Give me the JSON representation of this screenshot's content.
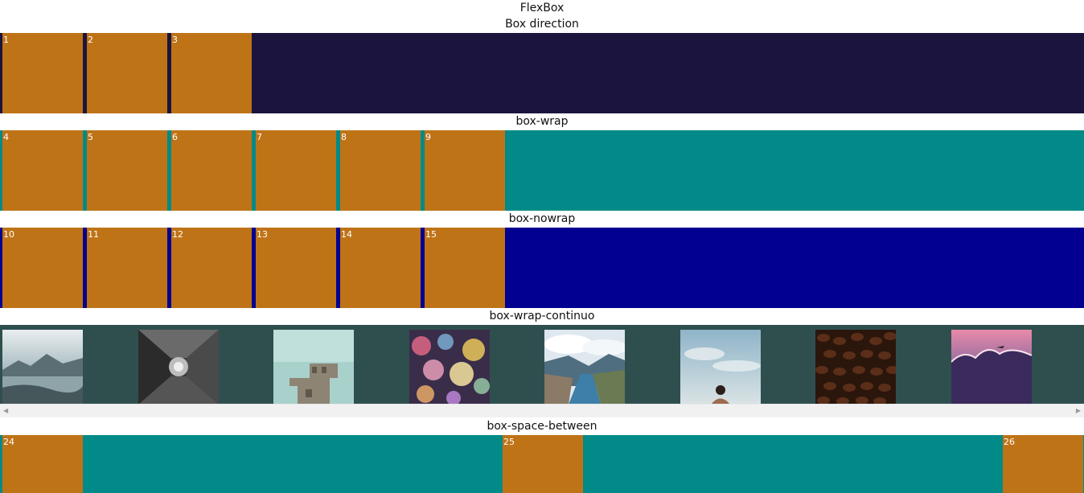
{
  "page": {
    "title": "FlexBox"
  },
  "colors": {
    "box": "#bf7317",
    "direction_bg": "#1b143e",
    "wrap_bg": "#018a87",
    "nowrap_bg": "#010091",
    "gallery_bg": "#2f4f4f",
    "between_bg": "#018a87"
  },
  "sections": {
    "direction": {
      "title": "Box direction",
      "boxes": [
        "1",
        "2",
        "3"
      ]
    },
    "wrap": {
      "title": "box-wrap",
      "boxes": [
        "4",
        "5",
        "6",
        "7",
        "8",
        "9"
      ]
    },
    "nowrap": {
      "title": "box-nowrap",
      "boxes": [
        "10",
        "11",
        "12",
        "13",
        "14",
        "15"
      ]
    },
    "gallery": {
      "title": "box-wrap-continuo",
      "images": [
        {
          "icon": "mountain-lake-photo"
        },
        {
          "icon": "architecture-ceiling-photo"
        },
        {
          "icon": "ruined-building-photo"
        },
        {
          "icon": "bokeh-lights-photo"
        },
        {
          "icon": "fjord-landscape-photo"
        },
        {
          "icon": "person-sky-photo"
        },
        {
          "icon": "coffee-beans-photo"
        },
        {
          "icon": "pink-clouds-plane-photo"
        }
      ]
    },
    "between": {
      "title": "box-space-between",
      "boxes": [
        "24",
        "25",
        "26"
      ]
    }
  }
}
